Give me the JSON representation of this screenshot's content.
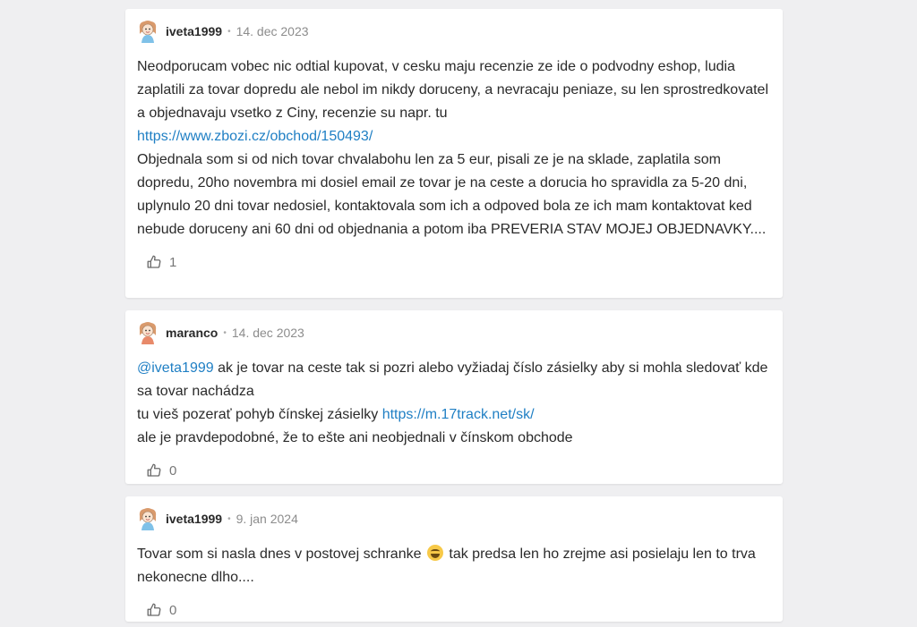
{
  "comments": [
    {
      "user": "iveta1999",
      "date": "14. dec 2023",
      "lines": [
        {
          "text": "Neodporucam vobec nic odtial kupovat, v cesku maju recenzie ze ide o podvodny eshop, ludia zaplatili za tovar dopredu ale nebol im nikdy doruceny, a nevracaju peniaze, su len sprostredkovatel a objednavaju vsetko z Ciny, recenzie su napr. tu"
        },
        {
          "link": "https://www.zbozi.cz/obchod/150493/"
        },
        {
          "text": "Objednala som si od nich tovar chvalabohu len za 5 eur, pisali ze je na sklade, zaplatila som dopredu, 20ho novembra mi dosiel email ze tovar je na ceste a dorucia ho spravidla za 5-20 dni, uplynulo 20 dni tovar nedosiel, kontaktovala som ich a odpoved bola ze ich mam kontaktovat ked nebude doruceny ani 60 dni od objednania a potom iba PREVERIA STAV MOJEJ OBJEDNAVKY...."
        }
      ],
      "likes": "1"
    },
    {
      "user": "maranco",
      "date": "14. dec 2023",
      "mention": "@iveta1999",
      "line1": " ak je tovar na ceste tak si pozri alebo vyžiadaj číslo zásielky aby si mohla sledovať kde sa tovar nachádza",
      "line2": "tu vieš pozerať pohyb čínskej zásielky ",
      "line2_link": "https://m.17track.net/sk/",
      "line3": "ale je pravdepodobné, že to ešte ani neobjednali v čínskom obchode",
      "likes": "0"
    },
    {
      "user": "iveta1999",
      "date": "9. jan 2024",
      "text_before": "Tovar som si nasla dnes v postovej schranke ",
      "emoji": "joy-emoji",
      "text_after": " tak predsa len ho zrejme asi posielaju len to trva nekonecne dlho....",
      "likes": "0"
    }
  ],
  "meta_separator": "•",
  "icons": {
    "like": "thumbs-up-icon",
    "avatar": "avatar-cartoon"
  },
  "colors": {
    "link": "#1f7fc4",
    "background": "#efeff1"
  }
}
